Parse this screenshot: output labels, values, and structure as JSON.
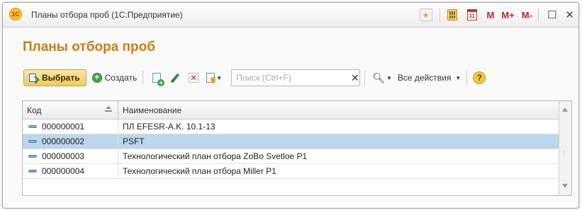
{
  "window": {
    "title": "Планы отбора проб  (1С:Предприятие)",
    "app_logo_text": "1С",
    "memory_buttons": [
      "M",
      "M+",
      "M-"
    ]
  },
  "form": {
    "title": "Планы отбора проб"
  },
  "toolbar": {
    "select_label": "Выбрать",
    "create_label": "Создать",
    "search_placeholder": "Поиск (Ctrl+F)",
    "search_value": "",
    "all_actions_label": "Все действия",
    "help_label": "?"
  },
  "table": {
    "columns": [
      {
        "label": "Код"
      },
      {
        "label": "Наименование"
      }
    ],
    "rows": [
      {
        "code": "000000001",
        "name": "ПЛ EFESR-A.K. 10.1-13",
        "selected": false
      },
      {
        "code": "000000002",
        "name": "PSFT",
        "selected": true
      },
      {
        "code": "000000003",
        "name": "Технологический план отбора ZoBo Svetloe P1",
        "selected": false
      },
      {
        "code": "000000004",
        "name": "Технологический план отбора Miller P1",
        "selected": false
      }
    ]
  },
  "colors": {
    "form_title": "#c97e14",
    "selected_row": "#bcd6ee",
    "select_button": "#efca63"
  }
}
